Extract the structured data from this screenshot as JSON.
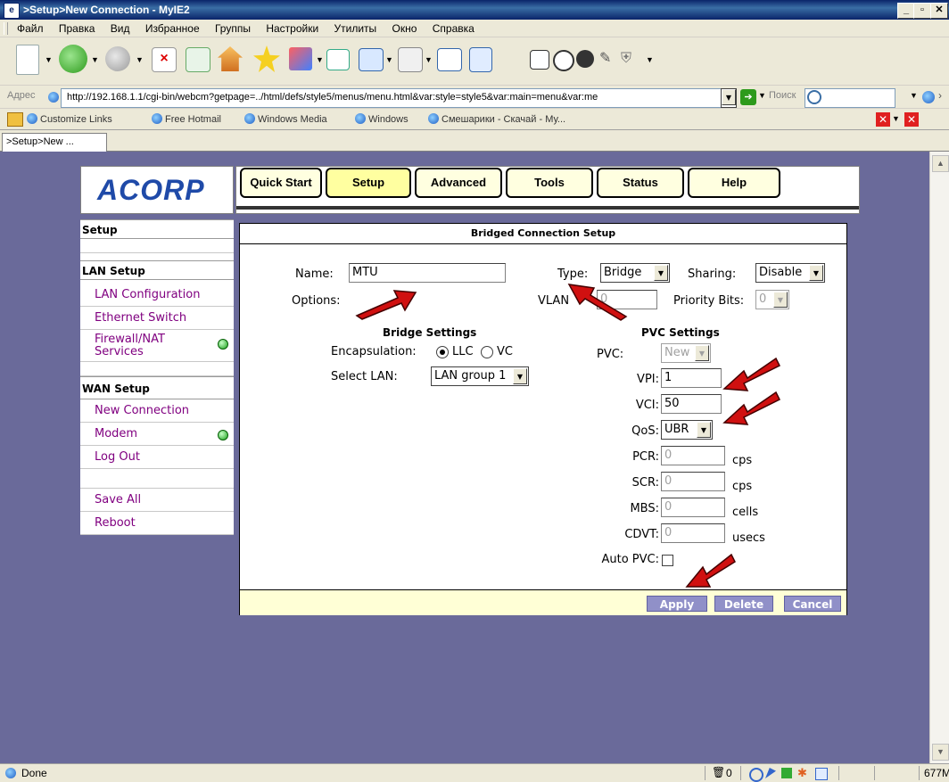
{
  "window": {
    "title": ">Setup>New Connection - MyIE2",
    "app_icon": "ie-icon",
    "controls": [
      "_",
      "▫",
      "✕"
    ]
  },
  "menu": [
    "Файл",
    "Правка",
    "Вид",
    "Избранное",
    "Группы",
    "Настройки",
    "Утилиты",
    "Окно",
    "Справка"
  ],
  "address": {
    "label": "Адрес",
    "url": "http://192.168.1.1/cgi-bin/webcm?getpage=../html/defs/style5/menus/menu.html&var:style=style5&var:main=menu&var:me",
    "search_label": "Поиск"
  },
  "links": [
    "Customize Links",
    "Free Hotmail",
    "Windows Media",
    "Windows",
    "Смешарики - Скачай - Му..."
  ],
  "tab": {
    "label": ">Setup>New ..."
  },
  "router": {
    "logo": "ACORP",
    "nav": [
      "Quick Start",
      "Setup",
      "Advanced",
      "Tools",
      "Status",
      "Help"
    ],
    "active_nav": "Setup",
    "sidebar": {
      "setup_head": "Setup",
      "lan_head": "LAN Setup",
      "lan_items": [
        "LAN Configuration",
        "Ethernet Switch",
        "Firewall/NAT Services"
      ],
      "wan_head": "WAN Setup",
      "wan_items": [
        "New Connection",
        "Modem",
        "Log Out"
      ],
      "extra_items": [
        "Save All",
        "Reboot"
      ]
    },
    "panel": {
      "title": "Bridged Connection Setup",
      "name_label": "Name:",
      "name_value": "MTU",
      "type_label": "Type:",
      "type_value": "Bridge",
      "sharing_label": "Sharing:",
      "sharing_value": "Disable",
      "options_label": "Options:",
      "vlan_label": "VLAN",
      "vlan_value": "0",
      "priority_label": "Priority Bits:",
      "priority_value": "0",
      "bridge_head": "Bridge Settings",
      "encap_label": "Encapsulation:",
      "encap_llc": "LLC",
      "encap_vc": "VC",
      "encap_selected": "LLC",
      "select_lan_label": "Select LAN:",
      "select_lan_value": "LAN group 1",
      "pvc_head": "PVC Settings",
      "pvc_label": "PVC:",
      "pvc_value": "New",
      "vpi_label": "VPI:",
      "vpi_value": "1",
      "vci_label": "VCI:",
      "vci_value": "50",
      "qos_label": "QoS:",
      "qos_value": "UBR",
      "pcr_label": "PCR:",
      "pcr_value": "0",
      "pcr_unit": "cps",
      "scr_label": "SCR:",
      "scr_value": "0",
      "scr_unit": "cps",
      "mbs_label": "MBS:",
      "mbs_value": "0",
      "mbs_unit": "cells",
      "cdvt_label": "CDVT:",
      "cdvt_value": "0",
      "cdvt_unit": "usecs",
      "autopvc_label": "Auto PVC:",
      "apply": "Apply",
      "delete": "Delete",
      "cancel": "Cancel"
    }
  },
  "status": {
    "text": "Done",
    "count": "0",
    "right": "677M"
  },
  "colors": {
    "page_bg": "#6a6a9a",
    "nav_bg": "#ffffe0",
    "button_bg": "#9090c8",
    "link": "#800080",
    "arrow": "#d01010"
  }
}
